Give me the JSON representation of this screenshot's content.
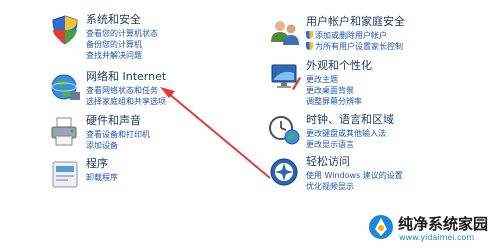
{
  "left_column": [
    {
      "title": "系统和安全",
      "icon": "shield-security-icon",
      "links": [
        {
          "text": "查看您的计算机状态",
          "shield": false
        },
        {
          "text": "备份您的计算机",
          "shield": false
        },
        {
          "text": "查找并解决问题",
          "shield": false
        }
      ]
    },
    {
      "title": "网络和 Internet",
      "icon": "network-globe-icon",
      "links": [
        {
          "text": "查看网络状态和任务",
          "shield": false
        },
        {
          "text": "选择家庭组和共享选项",
          "shield": false
        }
      ]
    },
    {
      "title": "硬件和声音",
      "icon": "printer-icon",
      "links": [
        {
          "text": "查看设备和打印机",
          "shield": false
        },
        {
          "text": "添加设备",
          "shield": false
        }
      ]
    },
    {
      "title": "程序",
      "icon": "programs-icon",
      "links": [
        {
          "text": "卸载程序",
          "shield": false
        }
      ]
    }
  ],
  "right_column": [
    {
      "title": "用户帐户和家庭安全",
      "icon": "users-icon",
      "links": [
        {
          "text": "添加或删除用户帐户",
          "shield": true
        },
        {
          "text": "为所有用户设置家长控制",
          "shield": true
        }
      ]
    },
    {
      "title": "外观和个性化",
      "icon": "appearance-icon",
      "links": [
        {
          "text": "更改主题",
          "shield": false
        },
        {
          "text": "更改桌面背景",
          "shield": false
        },
        {
          "text": "调整屏幕分辨率",
          "shield": false
        }
      ]
    },
    {
      "title": "时钟、语言和区域",
      "icon": "clock-globe-icon",
      "links": [
        {
          "text": "更改键盘或其他输入法",
          "shield": false
        },
        {
          "text": "更改显示语言",
          "shield": false
        }
      ]
    },
    {
      "title": "轻松访问",
      "icon": "ease-of-access-icon",
      "links": [
        {
          "text": "使用 Windows 建议的设置",
          "shield": false
        },
        {
          "text": "优化视频显示",
          "shield": false
        }
      ]
    }
  ],
  "annotation": {
    "color": "#e53935"
  },
  "watermark": {
    "site_name": "纯净系统家园",
    "url": "www.yidaimei.com"
  }
}
